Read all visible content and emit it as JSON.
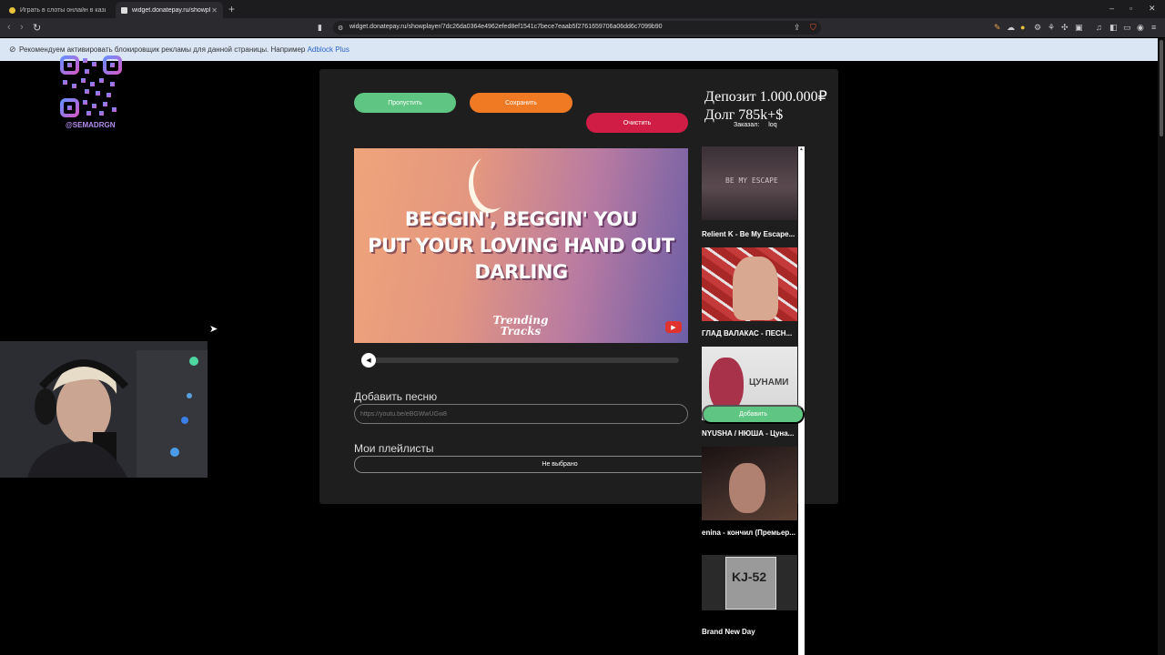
{
  "browser": {
    "tabs": [
      {
        "title": "Играть в слоты онлайн в казино Дэ",
        "favicon_color": "#e8c23a"
      },
      {
        "title": "widget.donatepay.ru/showpl",
        "favicon_color": "#dddddd"
      }
    ],
    "new_tab": "+",
    "window_controls": [
      "–",
      "▫",
      "✕"
    ],
    "url": "widget.donatepay.ru/showplayer/7dc26da0364e4962efed8ef1541c7bece7eaab5f2761659706a06dd6c7099b90",
    "infobar": {
      "message": "Рекомендуем активировать блокировщик рекламы для данной страницы. Например ",
      "link": "Adblock Plus"
    }
  },
  "overlay": {
    "qr_label": "@SEMADRGN"
  },
  "widget": {
    "buttons": {
      "skip": "Пропустить",
      "save": "Сохранить",
      "clear": "Очистить"
    },
    "info": {
      "deposit": "Депозит 1.000.000₽",
      "debt": "Долг  785k+$",
      "ordered_label": "Заказал:",
      "ordered_user": "loq"
    },
    "video": {
      "lyrics": [
        "BEGGIN', BEGGIN' YOU",
        "PUT YOUR LOVING HAND OUT",
        "DARLING"
      ],
      "brand": [
        "Trending",
        "Tracks"
      ]
    },
    "progress": 0.0,
    "add_song": {
      "label": "Добавить песню",
      "placeholder": "https://youtu.be/eBGWwUGw8"
    },
    "playlists": {
      "label": "Мои плейлисты",
      "selected": "Не выбрано"
    },
    "add_button": "Добавить",
    "suggestions": [
      {
        "title": "Relient K - Be My Escape...",
        "thumb_text": "BE MY ESCAPE"
      },
      {
        "title": "ГЛАД ВАЛАКАС - ПЕСН...",
        "thumb_text": ""
      },
      {
        "title": "NYUSHA / НЮША - Цуна...",
        "thumb_text": "ЦУНАМИ"
      },
      {
        "title": "enina - кончил (Премьер...",
        "thumb_text": ""
      },
      {
        "title": "Brand New Day",
        "thumb_text": "KJ-52"
      }
    ]
  },
  "colors": {
    "skip": "#5ec582",
    "save": "#f07a24",
    "clear": "#d01d45",
    "panel": "#1e1e1e"
  }
}
